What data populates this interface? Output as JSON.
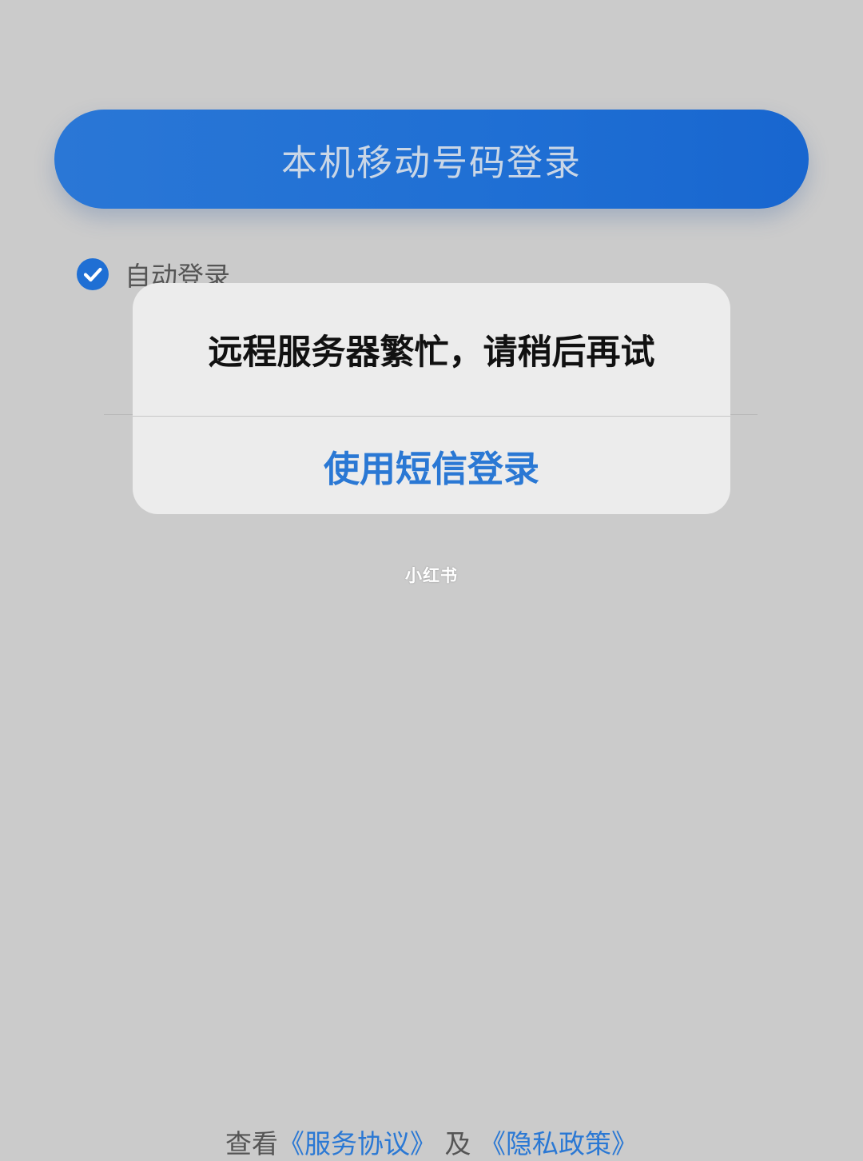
{
  "login": {
    "button_label": "本机移动号码登录"
  },
  "auto_login": {
    "label": "自动登录",
    "checked": true,
    "icon": "check-circle-icon"
  },
  "alert": {
    "message": "远程服务器繁忙，请稍后再试",
    "action_label": "使用短信登录"
  },
  "watermark": {
    "text": "小红书"
  },
  "footer": {
    "prefix": "查看",
    "service_link": "《服务协议》",
    "connector": "及",
    "privacy_link": "《隐私政策》"
  },
  "colors": {
    "background": "#cbcbcb",
    "primary": "#1f6fd4",
    "link": "#2a78d4",
    "alert_bg": "#ececec"
  }
}
